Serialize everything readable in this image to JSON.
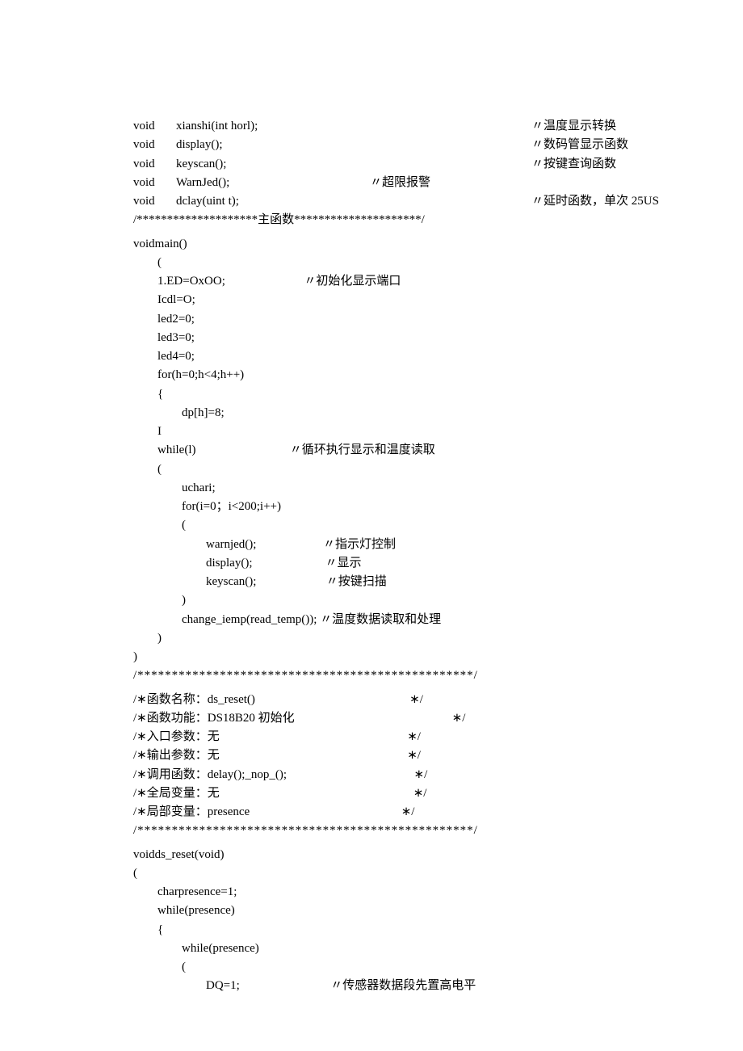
{
  "decl": [
    {
      "kw": "void",
      "sig": "xianshi(int horl);",
      "cmt": "〃温度显示转换"
    },
    {
      "kw": "void",
      "sig": "display();",
      "cmt": "〃数码管显示函数"
    },
    {
      "kw": "void",
      "sig": "keyscan();",
      "cmt": "〃按键查询函数"
    },
    {
      "kw": "void",
      "sig": "WarnJed();",
      "mid": "〃超限报警",
      "cmt": ""
    },
    {
      "kw": "void",
      "sig": "dclay(uint t);",
      "cmt": "〃延时函数，单次 25US"
    }
  ],
  "sep1": "/********************主函数*********************/",
  "main": [
    "voidmain()",
    "        (",
    "        1.ED=OxOO;                          〃初始化显示端口",
    "        Icdl=O;",
    "        led2=0;",
    "        led3=0;",
    "        led4=0;",
    "        for(h=0;h<4;h++)",
    "        {",
    "                dp[h]=8;",
    "        I",
    "        while(l)                               〃循环执行显示和温度读取",
    "        (",
    "                uchari;",
    "                for(i=0；i<200;i++)",
    "                (",
    "                        warnjed();                      〃指示灯控制",
    "                        display();                        〃显示",
    "                        keyscan();                       〃按键扫描",
    "                )",
    "                change_iemp(read_temp()); 〃温度数据读取和处理",
    "        )",
    ")"
  ],
  "sep2": "/*************************************************/",
  "cblock": [
    "/∗函数名称：ds_reset()                                                   ∗/",
    "/∗函数功能：DS18B20 初始化                                                    ∗/",
    "/∗入口参数：无                                                              ∗/",
    "/∗输出参数：无                                                              ∗/",
    "/∗调用函数：delay();_nop_();                                          ∗/",
    "/∗全局变量：无                                                                ∗/",
    "/∗局部变量：presence                                                  ∗/"
  ],
  "sep3": "/*************************************************/",
  "func": [
    "voidds_reset(void)",
    "(",
    "        charpresence=1;",
    "        while(presence)",
    "        {",
    "                while(presence)",
    "                (",
    "                        DQ=1;                              〃传感器数据段先置高电平"
  ]
}
